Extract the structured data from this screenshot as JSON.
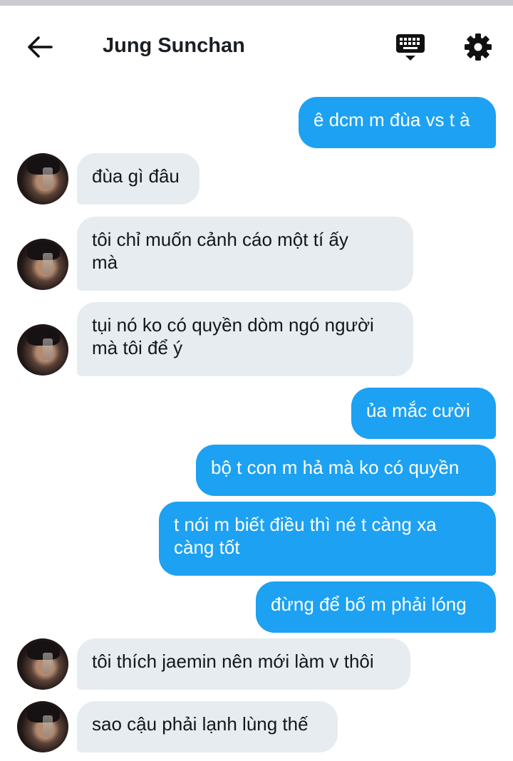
{
  "header": {
    "title": "Jung Sunchan",
    "back_icon": "arrow-left-icon",
    "keyboard_icon": "keyboard-icon",
    "settings_icon": "gear-icon"
  },
  "colors": {
    "outgoing_bubble": "#1da1f2",
    "incoming_bubble": "#e6ecf0",
    "title_text": "#1b1f24"
  },
  "messages": [
    {
      "direction": "out",
      "text": "ê dcm m đùa vs t à"
    },
    {
      "direction": "in",
      "text": "đùa gì đâu"
    },
    {
      "direction": "in",
      "text": "tôi chỉ muốn cảnh cáo một tí ấy\nmà"
    },
    {
      "direction": "in",
      "text": "tụi nó ko có quyền dòm ngó người\nmà tôi để ý"
    },
    {
      "direction": "out",
      "text": "ủa mắc cười"
    },
    {
      "direction": "out",
      "text": "bộ t con m hả mà ko có quyền"
    },
    {
      "direction": "out",
      "text": "t nói m biết điều thì né t càng xa\ncàng tốt"
    },
    {
      "direction": "out",
      "text": "đừng để bố m phải lóng"
    },
    {
      "direction": "in",
      "text": "tôi thích jaemin nên mới làm v thôi"
    },
    {
      "direction": "in",
      "text": "sao cậu phải lạnh lùng thế"
    }
  ]
}
